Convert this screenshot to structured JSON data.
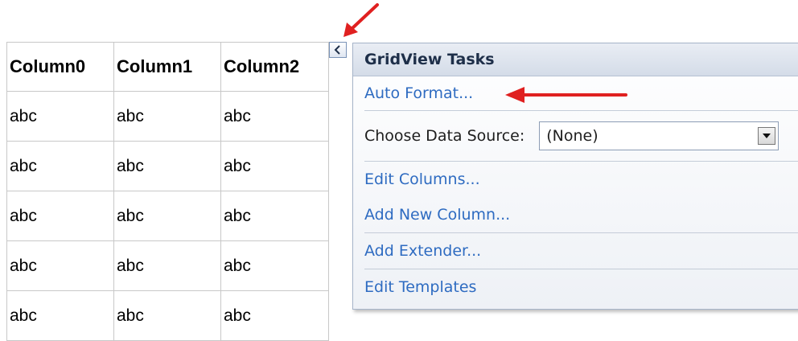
{
  "grid": {
    "headers": [
      "Column0",
      "Column1",
      "Column2"
    ],
    "rows": [
      [
        "abc",
        "abc",
        "abc"
      ],
      [
        "abc",
        "abc",
        "abc"
      ],
      [
        "abc",
        "abc",
        "abc"
      ],
      [
        "abc",
        "abc",
        "abc"
      ],
      [
        "abc",
        "abc",
        "abc"
      ]
    ]
  },
  "tasks_panel": {
    "title": "GridView Tasks",
    "auto_format": "Auto Format...",
    "choose_data_source_label": "Choose Data Source:",
    "data_source_value": "(None)",
    "edit_columns": "Edit Columns...",
    "add_new_column": "Add New Column...",
    "add_extender": "Add Extender...",
    "edit_templates": "Edit Templates"
  },
  "colors": {
    "annotation_arrow": "#e02020",
    "link": "#2e6bc1"
  },
  "icons": {
    "smart_tag": "chevron-left-icon",
    "dropdown": "triangle-down-icon",
    "annotation": "red-arrow-icon"
  }
}
